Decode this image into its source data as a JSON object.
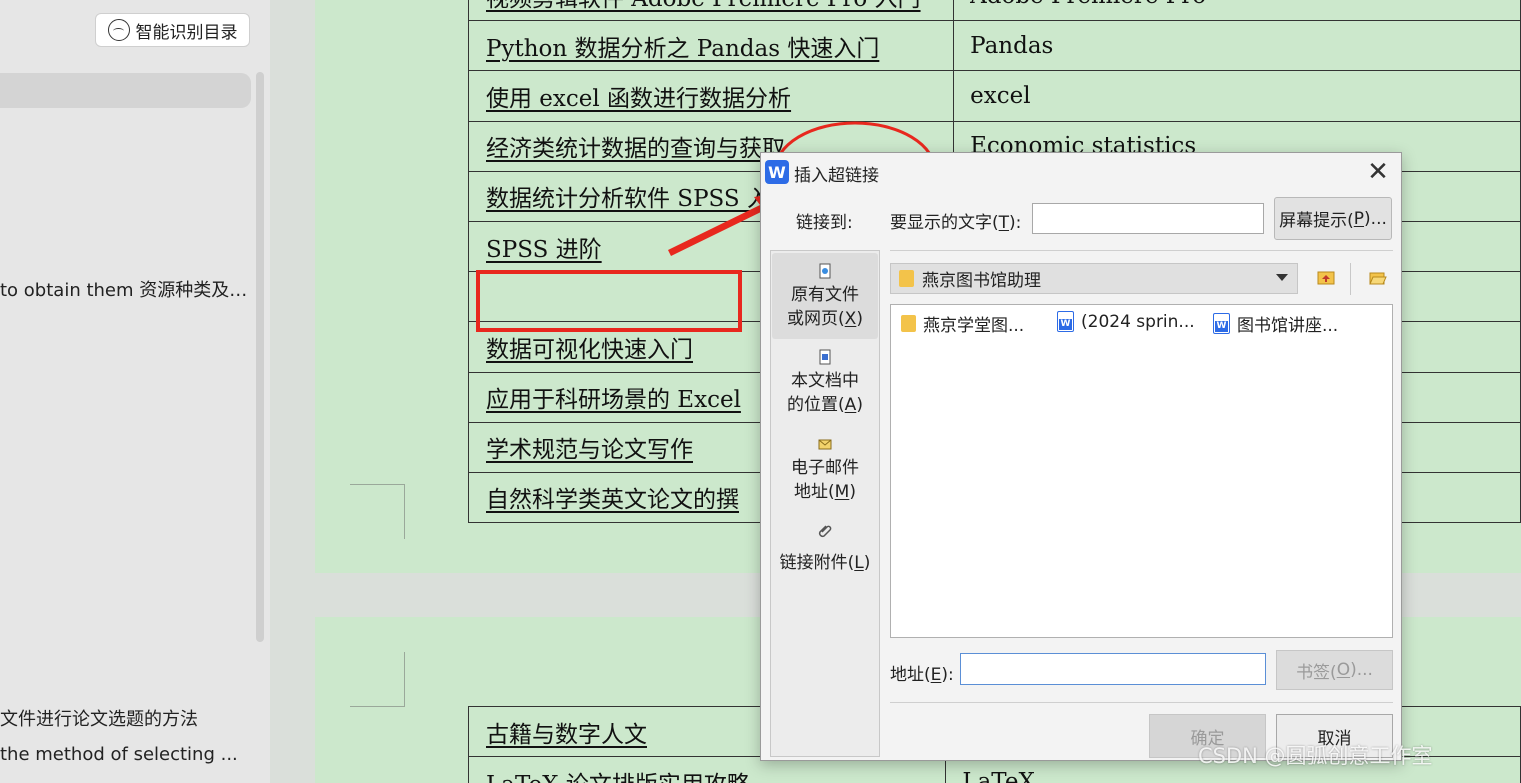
{
  "nav": {
    "smart_toc_button": "智能识别目录",
    "items": [
      "to obtain them 资源种类及 ...",
      "文件进行论文选题的方法",
      " the method of selecting ..."
    ]
  },
  "table_top": {
    "rows": [
      {
        "title": "视频剪辑软件 Adobe Premiere Pro 入门",
        "tool": "Adobe Premiere Pro"
      },
      {
        "title": "Python 数据分析之 Pandas 快速入门",
        "tool": "Pandas"
      },
      {
        "title": "使用 excel 函数进行数据分析",
        "tool": "excel"
      },
      {
        "title": "经济类统计数据的查询与获取",
        "tool": "Economic statistics"
      },
      {
        "title": "数据统计分析软件 SPSS 入门",
        "tool": ""
      },
      {
        "title": "SPSS 进阶",
        "tool": ""
      },
      {
        "title": "",
        "tool": ""
      },
      {
        "title": "数据可视化快速入门",
        "tool": ""
      },
      {
        "title": "应用于科研场景的 Excel",
        "tool": ""
      },
      {
        "title": "学术规范与论文写作",
        "tool": ""
      },
      {
        "title": "自然科学类英文论文的撰",
        "tool": ""
      }
    ]
  },
  "table_bottom": {
    "rows": [
      {
        "title": "古籍与数字人文",
        "tool": ""
      },
      {
        "title": "LaTeX 论文排版实用攻略",
        "tool": "LaTeX"
      }
    ]
  },
  "dialog": {
    "logo": "W",
    "title": "插入超链接",
    "close": "✕",
    "link_to_label": "链接到:",
    "display_text_label": "要显示的文字(",
    "display_text_key": "T",
    "display_text_suffix": "):",
    "display_text_value": "",
    "screentip_label": "屏幕提示(",
    "screentip_key": "P",
    "screentip_suffix": ")...",
    "left_items": [
      {
        "line1": "原有文件",
        "line2": "或网页(",
        "key": "X",
        "suffix": ")"
      },
      {
        "line1": "本文档中",
        "line2": "的位置(",
        "key": "A",
        "suffix": ")"
      },
      {
        "line1": "电子邮件",
        "line2": "地址(",
        "key": "M",
        "suffix": ")"
      },
      {
        "line1": "",
        "line2": "链接附件(",
        "key": "L",
        "suffix": ")"
      }
    ],
    "folder": "燕京图书馆助理",
    "files": [
      {
        "name": "燕京学堂图...",
        "type": "folder"
      },
      {
        "name": "(2024 sprin...",
        "type": "word"
      },
      {
        "name": "图书馆讲座...",
        "type": "word"
      }
    ],
    "address_label": "地址(",
    "address_key": "E",
    "address_suffix": "):",
    "address_value": "",
    "bookmark_label": "书签(",
    "bookmark_key": "O",
    "bookmark_suffix": ")...",
    "ok": "确定",
    "cancel": "取消"
  },
  "watermark": "CSDN @圆弧创意工作室",
  "colors": {
    "page_bg": "#cce8cc",
    "annotation_red": "#e8281e",
    "accent_blue": "#2d6be6"
  }
}
